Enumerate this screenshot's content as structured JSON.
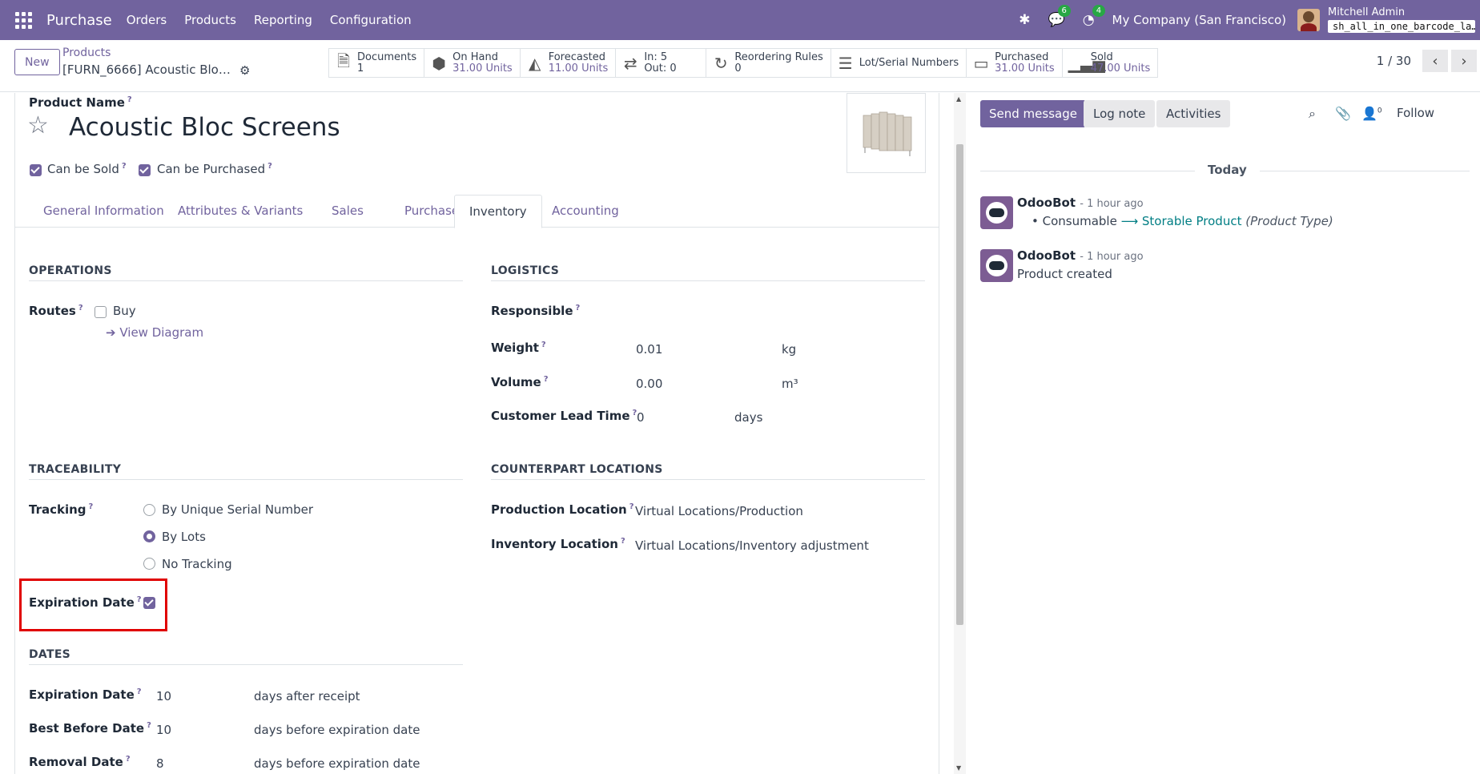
{
  "navbar": {
    "app_name": "Purchase",
    "menus": [
      "Orders",
      "Products",
      "Reporting",
      "Configuration"
    ],
    "messages_count": "6",
    "activities_count": "4",
    "company": "My Company (San Francisco)",
    "user_name": "Mitchell Admin",
    "database": "sh_all_in_one_barcode_la…"
  },
  "control": {
    "new_label": "New",
    "breadcrumb_parent": "Products",
    "breadcrumb_current": "[FURN_6666] Acoustic Bloc …",
    "pager_value": "1 / 30",
    "smart_buttons": [
      {
        "label": "Documents",
        "value": "1",
        "icon": "document-icon"
      },
      {
        "label": "On Hand",
        "value": "31.00 Units",
        "icon": "cubes-icon"
      },
      {
        "label": "Forecasted",
        "value": "11.00 Units",
        "icon": "area-chart-icon"
      },
      {
        "label": "In: 5",
        "value": "Out: 0",
        "icon": "exchange-icon"
      },
      {
        "label": "Reordering Rules",
        "value": "0",
        "icon": "refresh-icon"
      },
      {
        "label": "Lot/Serial Numbers",
        "value": "",
        "icon": "bars-icon"
      },
      {
        "label": "Purchased",
        "value": "31.00 Units",
        "icon": "credit-card-icon"
      },
      {
        "label": "Sold",
        "value": "47.00 Units",
        "icon": "signal-icon"
      }
    ]
  },
  "product": {
    "name_label": "Product Name",
    "name": "Acoustic Bloc Screens",
    "can_be_sold": "Can be Sold",
    "can_be_purchased": "Can be Purchased"
  },
  "tabs": [
    "General Information",
    "Attributes & Variants",
    "Sales",
    "Purchase",
    "Inventory",
    "Accounting"
  ],
  "operations": {
    "title": "OPERATIONS",
    "routes_label": "Routes",
    "route_buy": "Buy",
    "view_diagram": "View Diagram"
  },
  "logistics": {
    "title": "LOGISTICS",
    "responsible_label": "Responsible",
    "weight_label": "Weight",
    "weight_value": "0.01",
    "weight_unit": "kg",
    "volume_label": "Volume",
    "volume_value": "0.00",
    "volume_unit": "m³",
    "lead_time_label": "Customer Lead Time",
    "lead_time_value": "0",
    "lead_time_unit": "days"
  },
  "traceability": {
    "title": "TRACEABILITY",
    "tracking_label": "Tracking",
    "options": [
      "By Unique Serial Number",
      "By Lots",
      "No Tracking"
    ],
    "selected": "By Lots",
    "expiration_label": "Expiration Date"
  },
  "counterpart": {
    "title": "COUNTERPART LOCATIONS",
    "production_label": "Production Location",
    "production_value": "Virtual Locations/Production",
    "inventory_label": "Inventory Location",
    "inventory_value": "Virtual Locations/Inventory adjustment"
  },
  "dates": {
    "title": "DATES",
    "expiration_label": "Expiration Date",
    "expiration_value": "10",
    "expiration_unit": "days after receipt",
    "best_before_label": "Best Before Date",
    "best_before_value": "10",
    "best_before_unit": "days before expiration date",
    "removal_label": "Removal Date",
    "removal_value": "8",
    "removal_unit": "days before expiration date"
  },
  "chatter": {
    "send_message": "Send message",
    "log_note": "Log note",
    "activities": "Activities",
    "followers_count": "0",
    "follow": "Follow",
    "today": "Today",
    "messages": [
      {
        "author": "OdooBot",
        "time": "- 1 hour ago",
        "from": "Consumable",
        "to": "Storable Product",
        "field": "(Product Type)"
      },
      {
        "author": "OdooBot",
        "time": "- 1 hour ago",
        "body": "Product created"
      }
    ]
  }
}
